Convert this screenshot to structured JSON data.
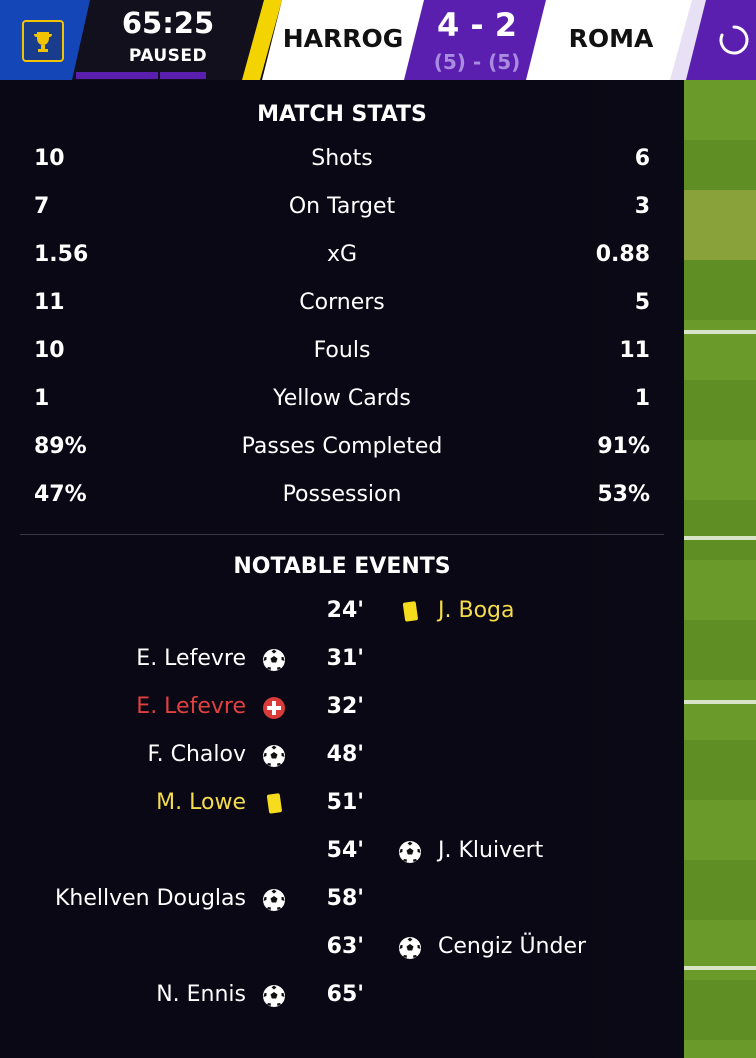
{
  "header": {
    "clock": "65:25",
    "status": "PAUSED",
    "home_team": "HARROG",
    "away_team": "ROMA",
    "score": "4 - 2",
    "penalties": "(5) - (5)"
  },
  "stats": {
    "title": "MATCH STATS",
    "rows": [
      {
        "label": "Shots",
        "home": "10",
        "away": "6"
      },
      {
        "label": "On Target",
        "home": "7",
        "away": "3"
      },
      {
        "label": "xG",
        "home": "1.56",
        "away": "0.88"
      },
      {
        "label": "Corners",
        "home": "11",
        "away": "5"
      },
      {
        "label": "Fouls",
        "home": "10",
        "away": "11"
      },
      {
        "label": "Yellow Cards",
        "home": "1",
        "away": "1"
      },
      {
        "label": "Passes Completed",
        "home": "89%",
        "away": "91%"
      },
      {
        "label": "Possession",
        "home": "47%",
        "away": "53%"
      }
    ]
  },
  "events": {
    "title": "NOTABLE EVENTS",
    "rows": [
      {
        "minute": "24'",
        "home_player": "",
        "away_player": "J. Boga",
        "type": "yellow-card-icon",
        "side": "away"
      },
      {
        "minute": "31'",
        "home_player": "E. Lefevre",
        "away_player": "",
        "type": "goal-ball-icon",
        "side": "home"
      },
      {
        "minute": "32'",
        "home_player": "E. Lefevre",
        "away_player": "",
        "type": "injury-icon",
        "side": "home"
      },
      {
        "minute": "48'",
        "home_player": "F. Chalov",
        "away_player": "",
        "type": "goal-ball-icon",
        "side": "home"
      },
      {
        "minute": "51'",
        "home_player": "M. Lowe",
        "away_player": "",
        "type": "yellow-card-icon",
        "side": "home"
      },
      {
        "minute": "54'",
        "home_player": "",
        "away_player": "J. Kluivert",
        "type": "goal-ball-icon",
        "side": "away"
      },
      {
        "minute": "58'",
        "home_player": "Khellven Douglas",
        "away_player": "",
        "type": "goal-ball-icon",
        "side": "home"
      },
      {
        "minute": "63'",
        "home_player": "",
        "away_player": "Cengiz Ünder",
        "type": "goal-ball-icon",
        "side": "away"
      },
      {
        "minute": "65'",
        "home_player": "N. Ennis",
        "away_player": "",
        "type": "goal-ball-icon",
        "side": "home"
      }
    ]
  },
  "colors": {
    "accent_purple": "#5b1fb0",
    "home_stripe": "#f4d400",
    "yellow_card": "#f5dc4c",
    "injury": "#e04040"
  }
}
